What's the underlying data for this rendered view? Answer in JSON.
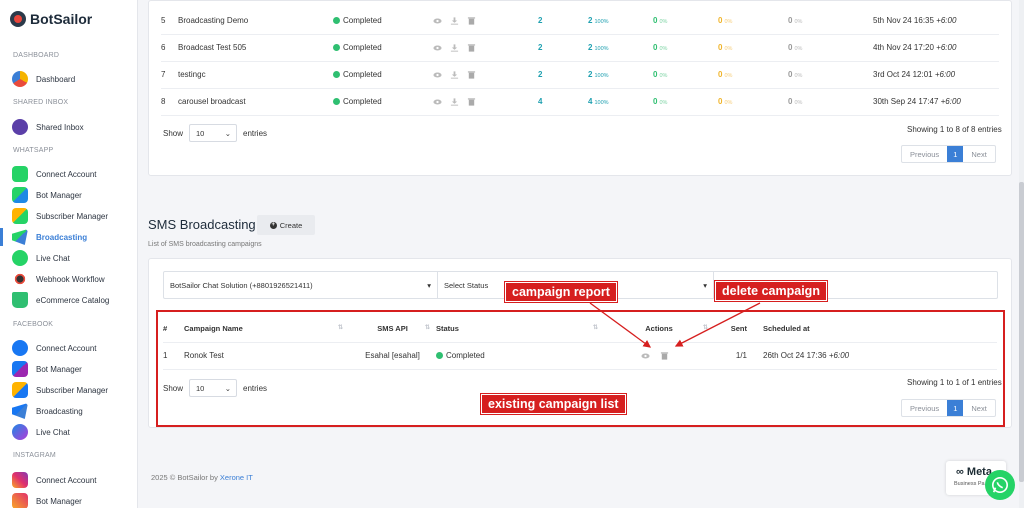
{
  "brand": {
    "name": "BotSailor"
  },
  "sidebar": {
    "sections": {
      "dashboard": "DASHBOARD",
      "shared_inbox": "SHARED INBOX",
      "whatsapp": "WHATSAPP",
      "facebook": "FACEBOOK",
      "instagram": "INSTAGRAM"
    },
    "items": {
      "dashboard": "Dashboard",
      "shared_inbox": "Shared Inbox",
      "wa_connect": "Connect Account",
      "wa_bot": "Bot Manager",
      "wa_subscriber": "Subscriber Manager",
      "wa_broadcasting": "Broadcasting",
      "wa_live_chat": "Live Chat",
      "wa_webhook": "Webhook Workflow",
      "wa_ecommerce": "eCommerce Catalog",
      "fb_connect": "Connect Account",
      "fb_bot": "Bot Manager",
      "fb_subscriber": "Subscriber Manager",
      "fb_broadcasting": "Broadcasting",
      "fb_live_chat": "Live Chat",
      "ig_connect": "Connect Account",
      "ig_bot": "Bot Manager"
    }
  },
  "broadcast_table": {
    "rows": [
      {
        "id": "5",
        "name": "Broadcasting Demo",
        "status": "Completed",
        "targeted": "2",
        "sent": "2",
        "sent_pct": "100%",
        "delivered": "0",
        "delivered_pct": "0%",
        "read": "0",
        "read_pct": "0%",
        "failed": "0",
        "failed_pct": "0%",
        "date": "5th Nov 24 16:35",
        "tz": "+6:00"
      },
      {
        "id": "6",
        "name": "Broadcast Test 505",
        "status": "Completed",
        "targeted": "2",
        "sent": "2",
        "sent_pct": "100%",
        "delivered": "0",
        "delivered_pct": "0%",
        "read": "0",
        "read_pct": "0%",
        "failed": "0",
        "failed_pct": "0%",
        "date": "4th Nov 24 17:20",
        "tz": "+6:00"
      },
      {
        "id": "7",
        "name": "testingc",
        "status": "Completed",
        "targeted": "2",
        "sent": "2",
        "sent_pct": "100%",
        "delivered": "0",
        "delivered_pct": "0%",
        "read": "0",
        "read_pct": "0%",
        "failed": "0",
        "failed_pct": "0%",
        "date": "3rd Oct 24 12:01",
        "tz": "+6:00"
      },
      {
        "id": "8",
        "name": "carousel broadcast",
        "status": "Completed",
        "targeted": "4",
        "sent": "4",
        "sent_pct": "100%",
        "delivered": "0",
        "delivered_pct": "0%",
        "read": "0",
        "read_pct": "0%",
        "failed": "0",
        "failed_pct": "0%",
        "date": "30th Sep 24 17:47",
        "tz": "+6:00"
      }
    ],
    "show_label": "Show",
    "entries_value": "10",
    "entries_label": "entries",
    "info": "Showing 1 to 8 of 8 entries",
    "pager": {
      "previous": "Previous",
      "page": "1",
      "next": "Next"
    }
  },
  "sms": {
    "title": "SMS Broadcasting",
    "create_label": "Create",
    "subtitle": "List of SMS broadcasting campaigns",
    "account_select": "BotSailor Chat Solution (+8801926521411)",
    "status_select": "Select Status",
    "headers": {
      "num": "#",
      "name": "Campaign Name",
      "api": "SMS API",
      "status": "Status",
      "actions": "Actions",
      "sent": "Sent",
      "scheduled": "Scheduled at"
    },
    "rows": [
      {
        "id": "1",
        "name": "Ronok Test",
        "api": "Esahal [esahal]",
        "status": "Completed",
        "sent": "1/1",
        "date": "26th Oct 24 17:36",
        "tz": "+6:00"
      }
    ],
    "show_label": "Show",
    "entries_value": "10",
    "entries_label": "entries",
    "info": "Showing 1 to 1 of 1 entries",
    "pager": {
      "previous": "Previous",
      "page": "1",
      "next": "Next"
    }
  },
  "annotations": {
    "report": "campaign report",
    "delete": "delete campaign",
    "list": "existing campaign list"
  },
  "footer": {
    "copyright": "2025 © BotSailor by ",
    "company": "Xerone IT"
  },
  "meta": {
    "name": "Meta",
    "sub": "Business Pa"
  },
  "colors": {
    "accent": "#3b7fd6",
    "completed": "#2fbf71",
    "annotation": "#d61f1f"
  }
}
